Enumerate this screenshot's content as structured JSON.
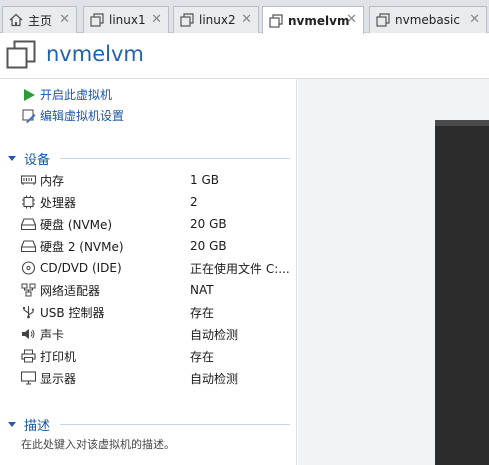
{
  "tabs": [
    {
      "label": "主页",
      "icon": "home-icon",
      "active": false
    },
    {
      "label": "linux1",
      "icon": "vm-icon",
      "active": false
    },
    {
      "label": "linux2",
      "icon": "vm-icon",
      "active": false
    },
    {
      "label": "nvmelvm",
      "icon": "vm-icon",
      "active": true
    },
    {
      "label": "nvmebasic",
      "icon": "vm-icon",
      "active": false
    }
  ],
  "tab_close": "✕",
  "header": {
    "title": "nvmelvm",
    "icon": "vm-icon"
  },
  "actions": {
    "power_on": "开启此虚拟机",
    "edit_settings": "编辑虚拟机设置"
  },
  "devices_section": {
    "title": "设备"
  },
  "devices": [
    {
      "name": "内存",
      "value": "1 GB",
      "icon": "memory-icon"
    },
    {
      "name": "处理器",
      "value": "2",
      "icon": "processor-icon"
    },
    {
      "name": "硬盘 (NVMe)",
      "value": "20 GB",
      "icon": "hard-disk-icon"
    },
    {
      "name": "硬盘 2 (NVMe)",
      "value": "20 GB",
      "icon": "hard-disk-icon"
    },
    {
      "name": "CD/DVD (IDE)",
      "value": "正在使用文件 C:...",
      "icon": "cd-dvd-icon"
    },
    {
      "name": "网络适配器",
      "value": "NAT",
      "icon": "network-adapter-icon"
    },
    {
      "name": "USB 控制器",
      "value": "存在",
      "icon": "usb-icon"
    },
    {
      "name": "声卡",
      "value": "自动检测",
      "icon": "speaker-icon"
    },
    {
      "name": "打印机",
      "value": "存在",
      "icon": "printer-icon"
    },
    {
      "name": "显示器",
      "value": "自动检测",
      "icon": "display-icon"
    }
  ],
  "description_section": {
    "title": "描述",
    "placeholder": "在此处键入对该虚拟机的描述。"
  },
  "colors": {
    "accent": "#1f62b3",
    "power_green": "#2e9b3a"
  }
}
